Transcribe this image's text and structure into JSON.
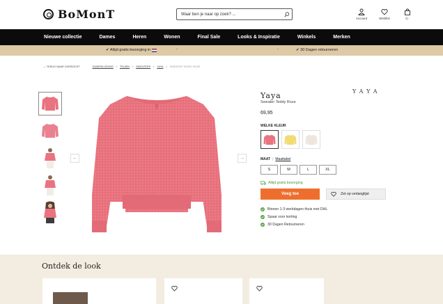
{
  "header": {
    "logo_text": "BoMonT",
    "search_placeholder": "Waar ben je naar op zoek? ...",
    "actions": [
      {
        "label": "Account",
        "icon": "user-icon"
      },
      {
        "label": "Wishlist",
        "icon": "heart-icon"
      },
      {
        "label": "0,-",
        "icon": "bag-icon"
      }
    ]
  },
  "nav": {
    "items": [
      "Nieuwe collectie",
      "Dames",
      "Heren",
      "Wonen",
      "Final Sale",
      "Looks & Inspiratie",
      "Winkels",
      "Merken"
    ]
  },
  "infobar": {
    "left": "✔ Altijd gratis bezorging in",
    "separator": "-",
    "right": "✔ 30 Dagen retourneren"
  },
  "breadcrumb": {
    "back": "← TERUG NAAR OVERZICHT",
    "items": [
      "DAMESKLEDING",
      "TRUIEN",
      "SWEATERS",
      "YAYA"
    ],
    "current": "SWEATER TEDDY ROZE"
  },
  "product": {
    "brand_logo": "YAYA",
    "title": "Yaya",
    "subtitle": "Sweater Teddy Roze",
    "price": "69,95",
    "color_label": "WELKE KLEUR",
    "colors": {
      "primary": "#e9737f",
      "yellow": "#f1dc72",
      "cream": "#ece6dc",
      "accent": "#ee6f2d",
      "green": "#5aa848"
    },
    "size_label": "MAAT",
    "size_separator": "|",
    "size_table": "Maattabel",
    "sizes": [
      "S",
      "M",
      "L",
      "XL"
    ],
    "free_shipping": "Altijd gratis bezorging",
    "add_to_cart": "Voeg toe",
    "wishlist": "Zet op verlanglijst",
    "usps": [
      "Binnen 1-3 werkdagen thuis met DHL",
      "Spaar voor korting",
      "30 Dagen Retourneren"
    ]
  },
  "gallery": {
    "prev": "←",
    "next": "→"
  },
  "look": {
    "title": "Ontdek de look"
  }
}
